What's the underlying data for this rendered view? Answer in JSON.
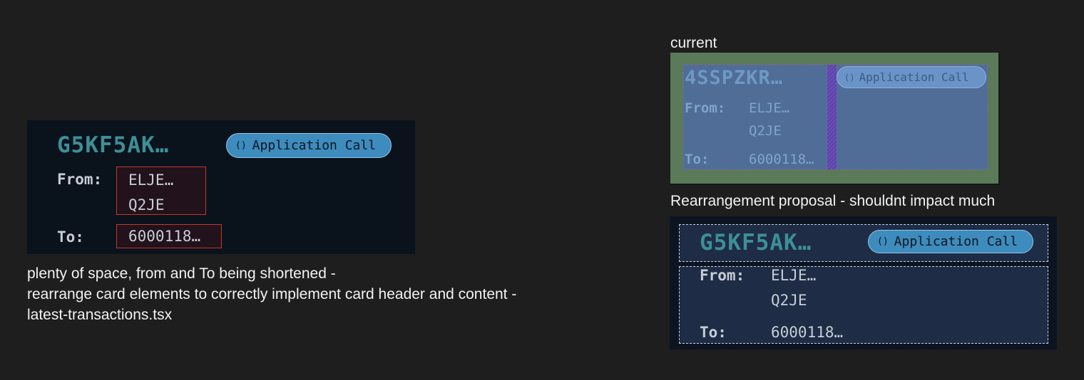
{
  "left_card": {
    "tx_id": "G5KF5AK…",
    "type_icon": "()",
    "type_label": "Application Call",
    "from_label": "From:",
    "from_value_1": "ELJE…",
    "from_value_2": "Q2JE",
    "to_label": "To:",
    "to_value": "6000118…",
    "highlight_color": "#c0392b"
  },
  "left_note": {
    "line1": "plenty of space, from and To being shortened -",
    "line2": "rearrange card elements to correctly implement card header and content -",
    "line3": "latest-transactions.tsx"
  },
  "current": {
    "title": "current",
    "tx_id": "4SSPZKR…",
    "type_icon": "()",
    "type_label": "Application Call",
    "from_label": "From:",
    "from_value_1": "ELJE…",
    "from_value_2": "Q2JE",
    "to_label": "To:",
    "to_value": "6000118…"
  },
  "proposal": {
    "title": "Rearrangement proposal - shouldnt impact much",
    "tx_id": "G5KF5AK…",
    "type_icon": "()",
    "type_label": "Application Call",
    "from_label": "From:",
    "from_value_1": "ELJE…",
    "from_value_2": "Q2JE",
    "to_label": "To:",
    "to_value": "6000118…"
  },
  "colors": {
    "background": "#1e1e1e",
    "card": "#0a121c",
    "accent_teal": "#3d8f96",
    "pill": "#3e8bbd",
    "proposal_section": "#1e2c46"
  }
}
